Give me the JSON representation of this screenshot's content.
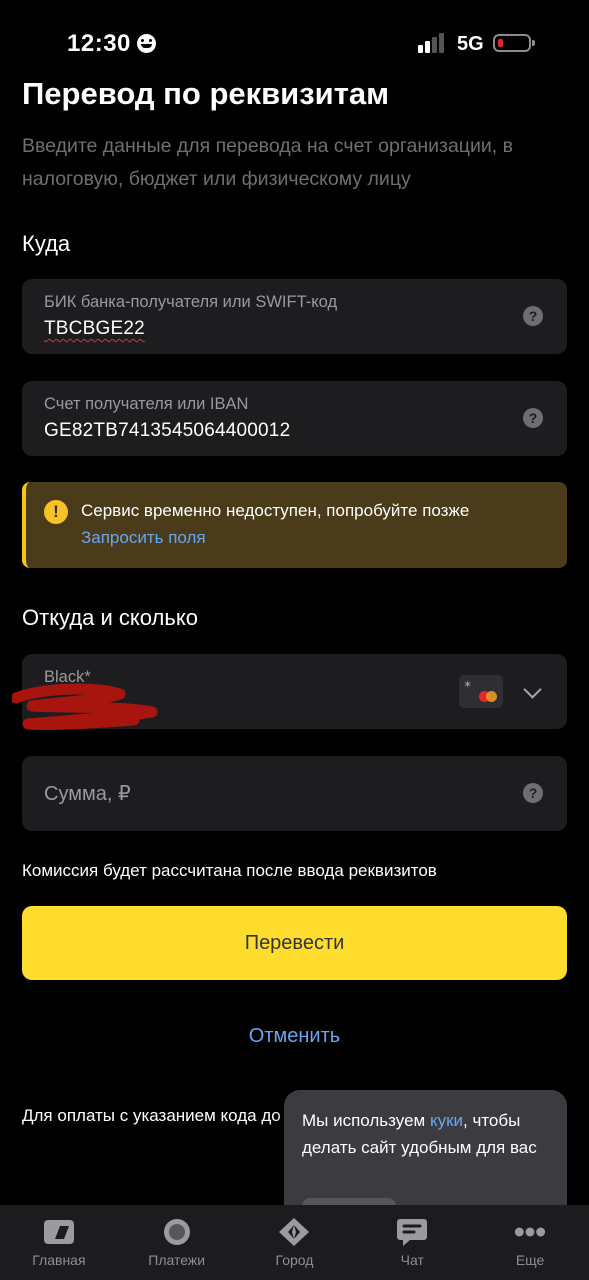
{
  "status_bar": {
    "time": "12:30",
    "network": "5G",
    "emoji_icon": "smiley-icon",
    "battery_level": 0.1
  },
  "header": {
    "title": "Перевод по реквизитам",
    "subtitle": "Введите данные для перевода на счет организации, в налоговую, бюджет или физическому лицу"
  },
  "destination": {
    "section_label": "Куда",
    "bik_field": {
      "label": "БИК банка-получателя или SWIFT-код",
      "value": "TBCBGE22"
    },
    "account_field": {
      "label": "Счет получателя или IBAN",
      "value": "GE82TB7413545064400012"
    }
  },
  "warning": {
    "message": "Сервис временно недоступен, попробуйте позже",
    "link": "Запросить поля",
    "icon": "!"
  },
  "source": {
    "section_label": "Откуда и сколько",
    "card": {
      "label": "Black*"
    },
    "amount_field": {
      "placeholder": "Сумма, ₽"
    }
  },
  "commission_note": "Комиссия будет рассчитана после ввода реквизитов",
  "actions": {
    "submit_label": "Перевести",
    "cancel_label": "Отменить"
  },
  "footer_text": "Для оплаты с указанием кода до контактный центр",
  "cookie_banner": {
    "text_before": "Мы используем ",
    "link": "куки",
    "text_after": ", чтобы делать сайт удобным для вас"
  },
  "help_icon": "?",
  "tab_bar": [
    {
      "label": "Главная",
      "icon": "home-icon"
    },
    {
      "label": "Платежи",
      "icon": "payments-icon"
    },
    {
      "label": "Город",
      "icon": "city-icon"
    },
    {
      "label": "Чат",
      "icon": "chat-icon"
    },
    {
      "label": "Еще",
      "icon": "more-icon"
    }
  ],
  "colors": {
    "accent_yellow": "#ffdd2d",
    "link_blue": "#6aa6f0",
    "warning_bg": "#4a3b1b",
    "field_bg": "#1d1d1f"
  }
}
